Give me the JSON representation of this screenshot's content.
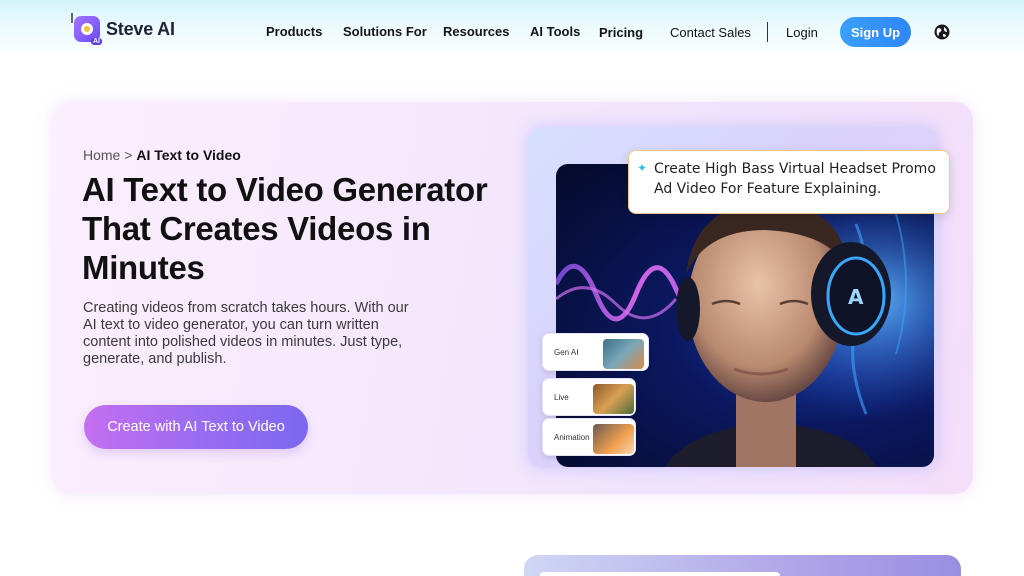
{
  "brand": {
    "name": "Steve AI",
    "badge": "AI"
  },
  "nav": {
    "items": [
      {
        "label": "Products"
      },
      {
        "label": "Solutions For"
      },
      {
        "label": "Resources"
      },
      {
        "label": "AI Tools"
      },
      {
        "label": "Pricing"
      }
    ],
    "contact_sales": "Contact Sales",
    "login": "Login",
    "sign_up": "Sign Up",
    "language_icon": "globe-icon"
  },
  "breadcrumb": {
    "home": "Home",
    "separator": ">",
    "current": "AI Text to Video"
  },
  "hero": {
    "title": "AI Text to Video Generator That Creates Videos in Minutes",
    "description": "Creating videos from scratch takes hours. With our AI text to video generator, you can turn written content into polished videos in minutes. Just type, generate, and publish.",
    "cta": "Create with AI Text to Video"
  },
  "visual": {
    "prompt": "Create High Bass Virtual Headset Promo Ad Video For Feature Explaining.",
    "prompt_icon": "sparkle-icon",
    "modes": [
      {
        "label": "Gen AI"
      },
      {
        "label": "Live"
      },
      {
        "label": "Animation"
      }
    ]
  },
  "colors": {
    "accent_blue": "#2f86f6",
    "cta_start": "#c66ef0",
    "cta_end": "#7b68f0",
    "hero_bg": "#f6e9fc"
  }
}
